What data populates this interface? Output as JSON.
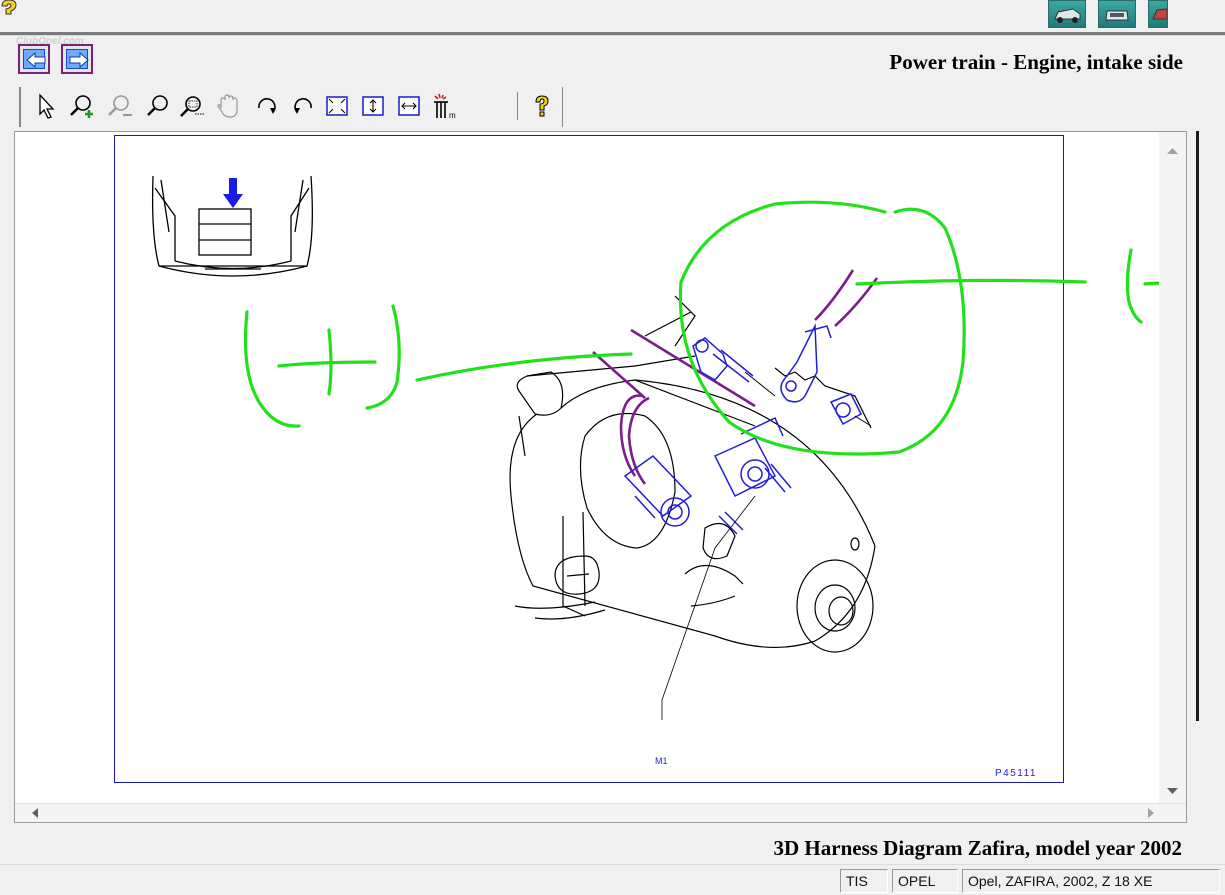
{
  "header": {
    "title": "Power train - Engine, intake side",
    "watermark": "ClubOpel.com"
  },
  "toolbar": {
    "tools": [
      {
        "name": "select-arrow-icon"
      },
      {
        "name": "zoom-in-icon"
      },
      {
        "name": "zoom-out-icon"
      },
      {
        "name": "zoom-icon"
      },
      {
        "name": "zoom-window-icon"
      },
      {
        "name": "pan-hand-icon"
      },
      {
        "name": "rotate-right-icon"
      },
      {
        "name": "rotate-left-icon"
      },
      {
        "name": "fit-all-icon"
      },
      {
        "name": "fit-height-icon"
      },
      {
        "name": "fit-width-icon"
      },
      {
        "name": "component-locate-icon"
      },
      {
        "name": "help-icon"
      }
    ]
  },
  "drawing": {
    "callout_label": "M1",
    "drawing_number": "P45111",
    "annotation_plus": "(+)",
    "annotation_minus": "(-)"
  },
  "caption": "3D Harness Diagram Zafira, model year 2002",
  "status": {
    "cell1": "TIS",
    "cell2": "OPEL",
    "cell3": "Opel, ZAFIRA, 2002, Z 18 XE"
  },
  "colors": {
    "annotation_green": "#22e01c",
    "wire_purple": "#7a1f8a",
    "part_blue": "#1f1fd8",
    "frame_blue": "#1a1aa8"
  }
}
